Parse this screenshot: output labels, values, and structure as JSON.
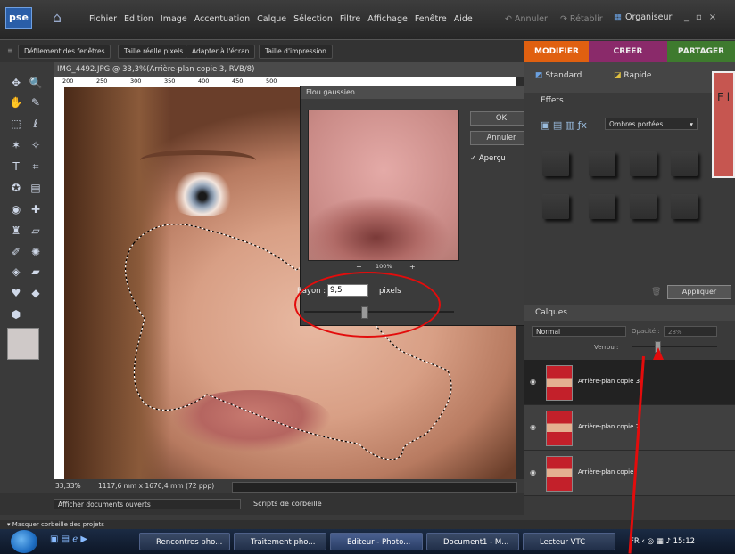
{
  "app": {
    "logo": "pse",
    "menu": [
      "Fichier",
      "Edition",
      "Image",
      "Accentuation",
      "Calque",
      "Sélection",
      "Filtre",
      "Affichage",
      "Fenêtre",
      "Aide"
    ],
    "undo": "Annuler",
    "redo": "Rétablir",
    "organizer": "Organiseur"
  },
  "options_bar": {
    "buttons": [
      "Défilement des fenêtres",
      "Taille réelle pixels",
      "Adapter à l'écran",
      "Taille d'impression"
    ]
  },
  "mode_tabs": [
    "MODIFIER",
    "CREER",
    "PARTAGER"
  ],
  "document": {
    "title": "IMG_4492.JPG @ 33,3%(Arrière-plan copie 3, RVB/8)",
    "ruler_ticks": [
      "200",
      "250",
      "300",
      "350",
      "400",
      "450",
      "500"
    ],
    "zoom": "33,33%",
    "size_info": "1117,6 mm x 1676,4 mm (72 ppp)"
  },
  "dialog": {
    "title": "Flou gaussien",
    "ok": "OK",
    "cancel": "Annuler",
    "preview_label": "Aperçu",
    "preview_checked": true,
    "zoom": "100%",
    "radius_label": "Rayon :",
    "radius_value": "9,5",
    "radius_unit": "pixels"
  },
  "panels": {
    "tab_standard": "Standard",
    "tab_rapide": "Rapide",
    "effects_title": "Effets",
    "effects_dropdown": "Ombres portées",
    "apply_button": "Appliquer",
    "red_box_text": "F l",
    "layers_title": "Calques",
    "blend_mode": "Normal",
    "opacity_label": "Opacité :",
    "opacity_value": "28%",
    "lock_label": "Verrou :",
    "layers": [
      {
        "name": "Arrière-plan copie 3",
        "selected": true
      },
      {
        "name": "Arrière-plan copie 2",
        "selected": false
      },
      {
        "name": "Arrière-plan copie",
        "selected": false
      }
    ]
  },
  "bottom": {
    "show_docs": "Afficher documents ouverts",
    "scripts": "Scripts de corbeille",
    "hide_bin": "Masquer corbeille des projets"
  },
  "taskbar": {
    "tasks": [
      "Rencontres pho...",
      "Traitement pho...",
      "Editeur - Photo...",
      "Document1 - M...",
      "Lecteur VTC"
    ],
    "lang": "FR",
    "time": "15:12"
  },
  "colors": {
    "modifier": "#e06010",
    "creer": "#8a2a6a",
    "partager": "#3e7a2e",
    "annotation": "#e30c0c"
  }
}
